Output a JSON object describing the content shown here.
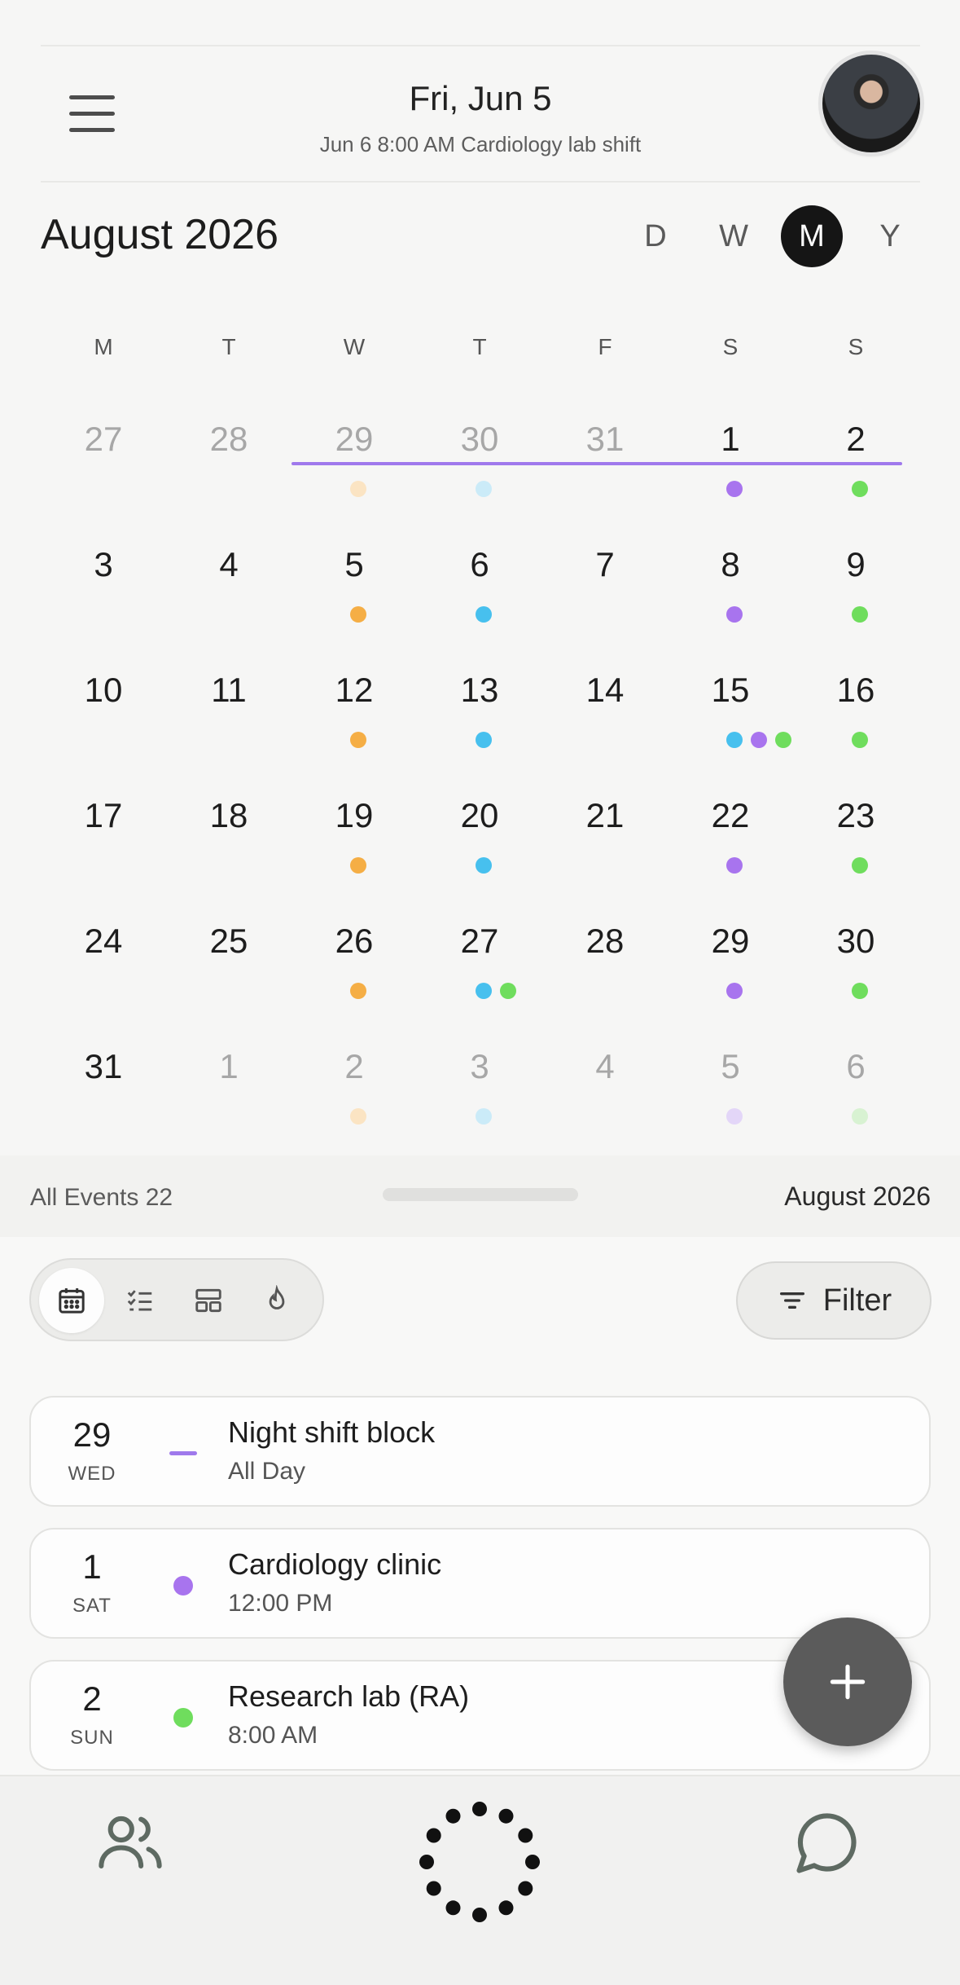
{
  "header": {
    "date": "Fri, Jun 5",
    "next_event": "Jun 6 8:00 AM Cardiology lab shift",
    "menu_icon": "hamburger-menu-icon",
    "avatar_icon": "profile-avatar"
  },
  "calendar": {
    "month_title": "August 2026",
    "views": [
      "D",
      "W",
      "M",
      "Y"
    ],
    "active_view": "M",
    "weekdays": [
      "M",
      "T",
      "W",
      "T",
      "F",
      "S",
      "S"
    ],
    "colors": {
      "orange": "#F5AE45",
      "blue": "#47C0EE",
      "purple": "#A874EE",
      "green": "#6FDD5D",
      "orange_faint": "#FBE4C3",
      "blue_faint": "#CBEBF8",
      "purple_faint": "#E3D6F8",
      "green_faint": "#D8F2D2",
      "range": "#9F79EC"
    },
    "weeks": [
      [
        {
          "d": "27",
          "muted": true,
          "dots": []
        },
        {
          "d": "28",
          "muted": true,
          "dots": []
        },
        {
          "d": "29",
          "muted": true,
          "dots": [
            "orange_faint"
          ]
        },
        {
          "d": "30",
          "muted": true,
          "dots": [
            "blue_faint"
          ]
        },
        {
          "d": "31",
          "muted": true,
          "dots": []
        },
        {
          "d": "1",
          "muted": false,
          "dots": [
            "purple"
          ]
        },
        {
          "d": "2",
          "muted": false,
          "dots": [
            "green"
          ]
        }
      ],
      [
        {
          "d": "3",
          "muted": false,
          "dots": []
        },
        {
          "d": "4",
          "muted": false,
          "dots": []
        },
        {
          "d": "5",
          "muted": false,
          "dots": [
            "orange"
          ]
        },
        {
          "d": "6",
          "muted": false,
          "dots": [
            "blue"
          ]
        },
        {
          "d": "7",
          "muted": false,
          "dots": []
        },
        {
          "d": "8",
          "muted": false,
          "dots": [
            "purple"
          ]
        },
        {
          "d": "9",
          "muted": false,
          "dots": [
            "green"
          ]
        }
      ],
      [
        {
          "d": "10",
          "muted": false,
          "dots": []
        },
        {
          "d": "11",
          "muted": false,
          "dots": []
        },
        {
          "d": "12",
          "muted": false,
          "dots": [
            "orange"
          ]
        },
        {
          "d": "13",
          "muted": false,
          "dots": [
            "blue"
          ]
        },
        {
          "d": "14",
          "muted": false,
          "dots": []
        },
        {
          "d": "15",
          "muted": false,
          "dots": [
            "blue",
            "purple",
            "green"
          ]
        },
        {
          "d": "16",
          "muted": false,
          "dots": [
            "green"
          ]
        }
      ],
      [
        {
          "d": "17",
          "muted": false,
          "dots": []
        },
        {
          "d": "18",
          "muted": false,
          "dots": []
        },
        {
          "d": "19",
          "muted": false,
          "dots": [
            "orange"
          ]
        },
        {
          "d": "20",
          "muted": false,
          "dots": [
            "blue"
          ]
        },
        {
          "d": "21",
          "muted": false,
          "dots": []
        },
        {
          "d": "22",
          "muted": false,
          "dots": [
            "purple"
          ]
        },
        {
          "d": "23",
          "muted": false,
          "dots": [
            "green"
          ]
        }
      ],
      [
        {
          "d": "24",
          "muted": false,
          "dots": []
        },
        {
          "d": "25",
          "muted": false,
          "dots": []
        },
        {
          "d": "26",
          "muted": false,
          "dots": [
            "orange"
          ]
        },
        {
          "d": "27",
          "muted": false,
          "dots": [
            "blue",
            "green"
          ]
        },
        {
          "d": "28",
          "muted": false,
          "dots": []
        },
        {
          "d": "29",
          "muted": false,
          "dots": [
            "purple"
          ]
        },
        {
          "d": "30",
          "muted": false,
          "dots": [
            "green"
          ]
        }
      ],
      [
        {
          "d": "31",
          "muted": false,
          "dots": []
        },
        {
          "d": "1",
          "muted": true,
          "dots": []
        },
        {
          "d": "2",
          "muted": true,
          "dots": [
            "orange_faint"
          ]
        },
        {
          "d": "3",
          "muted": true,
          "dots": [
            "blue_faint"
          ]
        },
        {
          "d": "4",
          "muted": true,
          "dots": []
        },
        {
          "d": "5",
          "muted": true,
          "dots": [
            "purple_faint"
          ]
        },
        {
          "d": "6",
          "muted": true,
          "dots": [
            "green_faint"
          ]
        }
      ]
    ],
    "multi_day_span": {
      "week": 0,
      "from_col": 2,
      "to_col": 6
    }
  },
  "sheet": {
    "all_events_label": "All Events 22",
    "month_label": "August 2026",
    "segments": [
      "calendar-icon",
      "checklist-icon",
      "layout-icon",
      "flame-icon"
    ],
    "active_segment": 0,
    "filter_label": "Filter",
    "filter_icon": "filter-lines-icon"
  },
  "events": [
    {
      "day": "29",
      "weekday": "WED",
      "title": "Night shift block",
      "time": "All Day",
      "marker": "bar",
      "color": "#9F79EC"
    },
    {
      "day": "1",
      "weekday": "SAT",
      "title": "Cardiology clinic",
      "time": "12:00 PM",
      "marker": "dot",
      "color": "#A874EE"
    },
    {
      "day": "2",
      "weekday": "SUN",
      "title": "Research lab (RA)",
      "time": "8:00 AM",
      "marker": "dot",
      "color": "#6FDD5D"
    }
  ],
  "fab_icon": "plus-icon",
  "bottom_nav": [
    "people-icon",
    "loading-dots-icon",
    "chat-bubble-icon"
  ]
}
